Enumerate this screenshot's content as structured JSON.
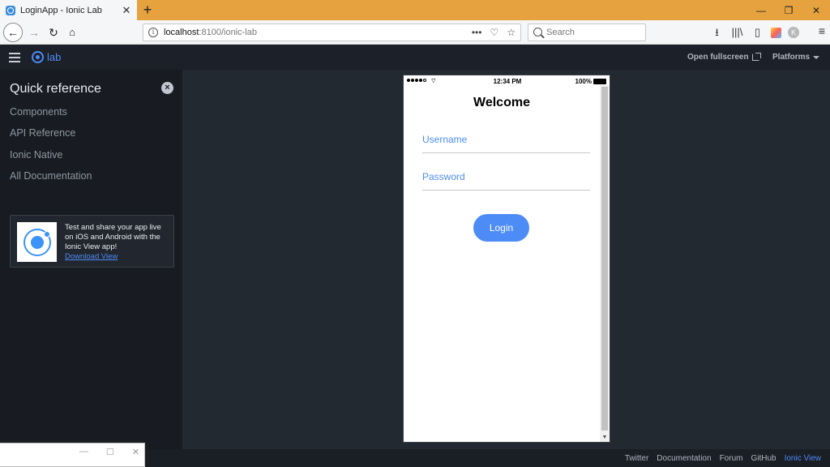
{
  "browser": {
    "tab_title": "LoginApp - Ionic Lab",
    "tab_close": "✕",
    "new_tab": "+",
    "url_host": "localhost",
    "url_path": ":8100/ionic-lab",
    "url_info": "i",
    "url_more": "•••",
    "url_pocket": "♡",
    "url_bookmark": "☆",
    "search_placeholder": "Search",
    "nav_back": "←",
    "nav_forward": "→",
    "nav_reload": "↻",
    "nav_home": "⌂",
    "tb_download": "⭳",
    "tb_library": "|||\\",
    "tb_sidebar": "▯",
    "tb_avatar": "K",
    "tb_menu": "≡",
    "win_minimize": "—",
    "win_restore": "❐",
    "win_close": "✕"
  },
  "lab": {
    "logo_text": "lab",
    "open_fullscreen": "Open fullscreen",
    "platforms": "Platforms"
  },
  "sidebar": {
    "title": "Quick reference",
    "close": "×",
    "links": [
      "Components",
      "API Reference",
      "Ionic Native",
      "All Documentation"
    ],
    "promo_text": "Test and share your app live on iOS and Android with the Ionic View app!",
    "promo_link": "Download View"
  },
  "device": {
    "wifi": "⌔",
    "time": "12:34 PM",
    "battery": "100%",
    "title": "Welcome",
    "username_placeholder": "Username",
    "password_placeholder": "Password",
    "login_label": "Login",
    "scroll_down": "▼"
  },
  "footer": {
    "links": [
      "Twitter",
      "Documentation",
      "Forum",
      "GitHub",
      "Ionic View"
    ]
  },
  "mini_window": {
    "minimize": "—",
    "maximize": "☐",
    "close": "✕"
  },
  "colors": {
    "accent": "#4d8cf6",
    "titlebar": "#e6a23e",
    "sidebar_bg": "#181b21",
    "stage_bg": "#232931"
  }
}
